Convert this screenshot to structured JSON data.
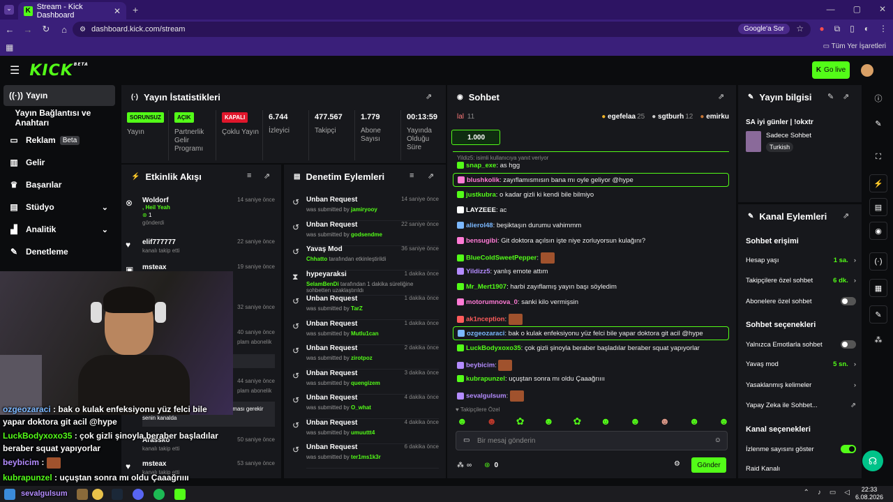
{
  "browser": {
    "tab_title": "Stream - Kick Dashboard",
    "url": "dashboard.kick.com/stream",
    "google_search": "Google'a Sor",
    "bookmarks_all": "Tüm Yer İşaretleri"
  },
  "header": {
    "logo": "KICK",
    "beta": "BETA",
    "go_live": "Go live"
  },
  "sidebar": {
    "items": [
      {
        "label": "Yayın",
        "icon": "broadcast-icon"
      },
      {
        "label": "Yayın Bağlantısı ve Anahtarı",
        "icon": "link-icon"
      },
      {
        "label": "Reklam",
        "icon": "ad-icon",
        "badge": "Beta"
      },
      {
        "label": "Gelir",
        "icon": "chart-icon"
      },
      {
        "label": "Başarılar",
        "icon": "trophy-icon"
      },
      {
        "label": "Stüdyo",
        "icon": "studio-icon"
      },
      {
        "label": "Analitik",
        "icon": "analytics-icon"
      },
      {
        "label": "Denetleme",
        "icon": "wrench-icon"
      }
    ]
  },
  "stats": {
    "title": "Yayın İstatistikleri",
    "items": [
      {
        "pill": "SORUNSUZ",
        "label": "Yayın"
      },
      {
        "pill": "AÇIK",
        "label": "Partnerlik Gelir Programı"
      },
      {
        "pill": "KAPALI",
        "label": "Çoklu Yayın"
      },
      {
        "value": "6.744",
        "label": "İzleyici"
      },
      {
        "value": "477.567",
        "label": "Takipçi"
      },
      {
        "value": "1.779",
        "label": "Abone Sayısı"
      },
      {
        "value": "00:13:59",
        "label": "Yayında Olduğu Süre"
      }
    ]
  },
  "feed": {
    "title": "Etkinlik Akışı",
    "items": [
      {
        "name": "Woldorf",
        "sub1": ", Heil Yeah",
        "sub2": "1",
        "sub3": "gönderdi",
        "time": "14 saniye önce"
      },
      {
        "name": "elif777777",
        "sub": "kanalı takip etti",
        "time": "22 saniye önce"
      },
      {
        "name": "msteax",
        "time": "19 saniye önce"
      },
      {
        "time": "32 saniye önce"
      },
      {
        "time": "40 saniye önce",
        "sub": "plam abonelik"
      },
      {
        "time": "44 saniye önce",
        "sub": "plam abonelik"
      },
      {
        "sub": "olmaması gerekir",
        "sub2": "senin kanalda"
      },
      {
        "name": "Arassko",
        "sub": "kanalı takip etti",
        "time": "50 saniye önce"
      },
      {
        "name": "msteax",
        "sub": "kanalı takip etti",
        "time": "53 saniye önce"
      }
    ]
  },
  "moderation": {
    "title": "Denetim Eylemleri",
    "items": [
      {
        "name": "Unban Request",
        "pre": "was submitted by",
        "user": "jamiryooy",
        "time": "14 saniye önce"
      },
      {
        "name": "Unban Request",
        "pre": "was submitted by",
        "user": "godsendme",
        "time": "22 saniye önce"
      },
      {
        "name": "Yavaş Mod",
        "user": "Chhatto",
        "post": "tarafından etkinleştirildi",
        "time": "36 saniye önce"
      },
      {
        "name": "hypeyaraksi",
        "user": "SelamBenDi",
        "post": "tarafından 1 dakika süreliğine sohbetten uzaklaştırıldı",
        "time": "1 dakika önce"
      },
      {
        "name": "Unban Request",
        "pre": "was submitted by",
        "user": "TarZ",
        "time": "1 dakika önce"
      },
      {
        "name": "Unban Request",
        "pre": "was submitted by",
        "user": "Mutlu1can",
        "time": "1 dakika önce"
      },
      {
        "name": "Unban Request",
        "pre": "was submitted by",
        "user": "zirotpoz",
        "time": "2 dakika önce"
      },
      {
        "name": "Unban Request",
        "pre": "was submitted by",
        "user": "quengizem",
        "time": "3 dakika önce"
      },
      {
        "name": "Unban Request",
        "pre": "was submitted by",
        "user": "O_what",
        "time": "4 dakika önce"
      },
      {
        "name": "Unban Request",
        "pre": "was submitted by",
        "user": "umuuttt4",
        "time": "4 dakika önce"
      },
      {
        "name": "Unban Request",
        "pre": "was submitted by",
        "user": "ter1ms1k3r",
        "time": "6 dakika önce"
      }
    ]
  },
  "chat": {
    "title": "Sohbet",
    "top": [
      {
        "name": "lal",
        "count": "11"
      },
      {
        "name": "egefelaa",
        "count": "25"
      },
      {
        "name": "sgtburh",
        "count": "12"
      },
      {
        "name": "emirku",
        "count": ""
      }
    ],
    "goal": "1.000",
    "reply_hint": "Yildiz5: isimli kullanıcıya yanıt veriyor",
    "messages": [
      {
        "user": "snap_exe",
        "color": "#53fc18",
        "text": "as hgg"
      },
      {
        "user": "blushkolik",
        "color": "#ff7bd5",
        "text": "zayıflamısmısın bana mı oyle geliyor @hype",
        "hl": true
      },
      {
        "user": "justkubra",
        "color": "#53fc18",
        "text": "o kadar gizli ki kendi bile bilmiyo"
      },
      {
        "user": "LAYZEEE",
        "color": "#ffffff",
        "text": "ac"
      },
      {
        "user": "alierol48",
        "color": "#7bb8ff",
        "text": "beşiktaşın durumu vahimmm"
      },
      {
        "user": "bensugibi",
        "color": "#ff7bd5",
        "text": "Git doktora açılsın işte niye zorluyorsun kulağını?"
      },
      {
        "user": "BlueColdSweetPepper",
        "color": "#53fc18",
        "text": ""
      },
      {
        "user": "Yildizz5",
        "color": "#b48cff",
        "text": "yanlış emote attım"
      },
      {
        "user": "Mr_Mert1907",
        "color": "#53fc18",
        "text": "harbi zayıflamış yayın başı söyledim"
      },
      {
        "user": "motorumnova_0",
        "color": "#ff7bd5",
        "text": "sanki kilo vermişsin"
      },
      {
        "user": "ak1nception",
        "color": "#ff5c5c",
        "text": ""
      },
      {
        "user": "ozgeozaraci",
        "color": "#7bb8ff",
        "text": "bak o kulak enfeksiyonu yüz felci bile yapar doktora git acil @hype",
        "hl": true
      },
      {
        "user": "LuckBodyxoxo35",
        "color": "#53fc18",
        "text": "çok gizli şinoyla beraber başladılar beraber squat yapıyorlar"
      },
      {
        "user": "beybicim",
        "color": "#b48cff",
        "text": ""
      },
      {
        "user": "kubrapunzel",
        "color": "#53fc18",
        "text": "uçuştan sonra mı oldu Çaaağrıııı"
      },
      {
        "user": "sevalgulsum",
        "color": "#b48cff",
        "text": ""
      }
    ],
    "followers_only": "Takipçilere Özel",
    "input_placeholder": "Bir mesaj gönderin",
    "points": "0",
    "send": "Gönder"
  },
  "stream_info": {
    "title": "Yayın bilgisi",
    "stream_title": "SA iyi günler | !okxtr",
    "category": "Sadece Sohbet",
    "language": "Turkish"
  },
  "channel_actions": {
    "title": "Kanal Eylemleri",
    "sec1": "Sohbet erişimi",
    "account_age": "Hesap yaşı",
    "account_age_val": "1 sa.",
    "followers_chat": "Takipçilere özel sohbet",
    "followers_chat_val": "6 dk.",
    "subs_chat": "Abonelere özel sohbet",
    "sec2": "Sohbet seçenekleri",
    "emote_only": "Yalnızca Emotlarla sohbet",
    "slow_mode": "Yavaş mod",
    "slow_mode_val": "5 sn.",
    "banned_words": "Yasaklanmış kelimeler",
    "ai_chat": "Yapay Zeka ile Sohbet...",
    "sec3": "Kanal seçenekleri",
    "show_views": "İzlenme sayısını göster",
    "raid": "Raid Kanalı"
  },
  "overlay": {
    "l1u": "ozgeozaraci",
    "l1": "bak o kulak enfeksiyonu yüz felci bile yapar doktora git acil @hype",
    "l2u": "LuckBodyxoxo35",
    "l2": "çok gizli şinoyla beraber başladılar beraber squat yapıyorlar",
    "l3u": "beybicim",
    "l4u": "kubrapunzel",
    "l4": "uçuştan sonra mı oldu Çaaağrıııı",
    "l5u": "sevalgulsum"
  },
  "taskbar": {
    "time": "22:33",
    "date": "6.08.2026"
  }
}
